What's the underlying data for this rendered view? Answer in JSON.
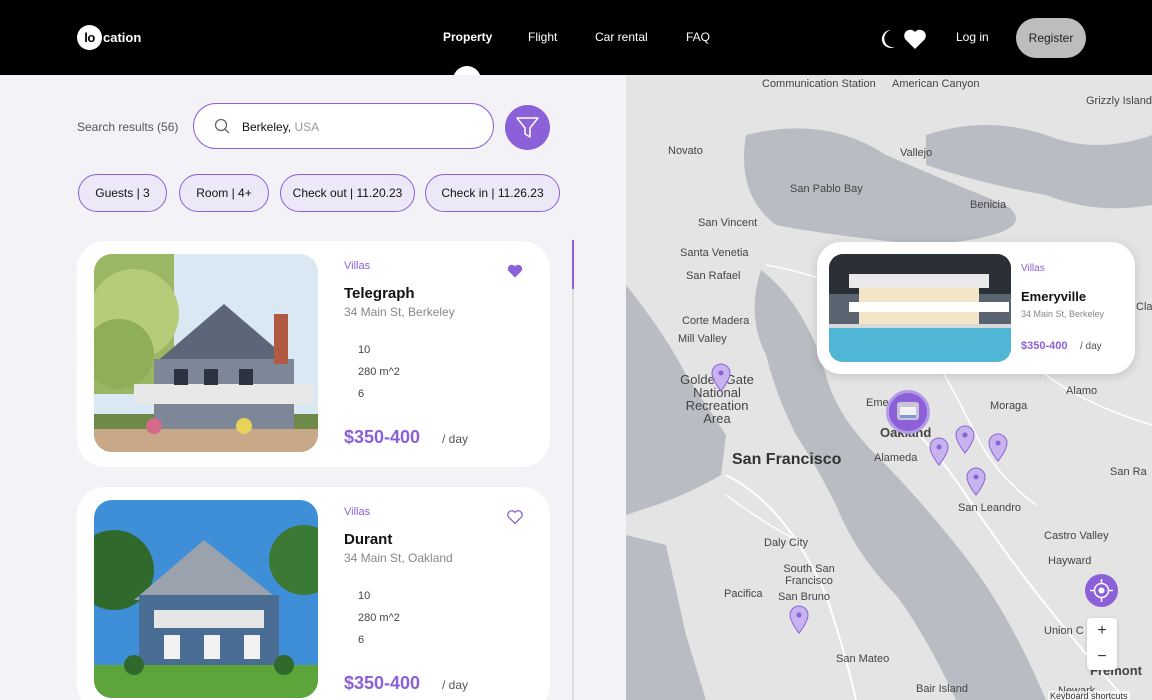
{
  "header": {
    "logo_mark": "lo",
    "logo_rest": "cation",
    "nav": [
      "Property",
      "Flight",
      "Car rental",
      "FAQ"
    ],
    "active_nav": "Property",
    "login": "Log in",
    "register": "Register"
  },
  "search": {
    "results_label": "Search results (56)",
    "city": "Berkeley,",
    "country": " USA"
  },
  "filters": [
    "Guests | 3",
    "Room | 4+",
    "Check out | 11.20.23",
    "Check in | 11.26.23"
  ],
  "listings": [
    {
      "category": "Villas",
      "name": "Telegraph",
      "address": "34 Main St, Berkeley",
      "specs": [
        "10",
        "280 m^2",
        "6"
      ],
      "price": "$350-400",
      "per": "/ day",
      "favorited": true
    },
    {
      "category": "Villas",
      "name": "Durant",
      "address": "34 Main St, Oakland",
      "specs": [
        "10",
        "280 m^2",
        "6"
      ],
      "price": "$350-400",
      "per": "/ day",
      "favorited": false
    }
  ],
  "map": {
    "popup": {
      "category": "Villas",
      "name": "Emeryville",
      "address": "34 Main St, Berkeley",
      "price": "$350-400",
      "per": "/ day"
    },
    "labels": {
      "communication": "Communication Station",
      "american": "American Canyon",
      "grizzly": "Grizzly Island Wildlife Are",
      "novato": "Novato",
      "vallejo": "Vallejo",
      "sanpablo": "San Pablo Bay",
      "benicia": "Benicia",
      "vincent": "San Vincent",
      "venetia": "Santa Venetia",
      "rafael": "San Rafael",
      "clay": "Clay",
      "corte": "Corte Madera",
      "mill": "Mill Valley",
      "golden": "Golden Gate National Recreation Area",
      "alamo": "Alamo",
      "moraga": "Moraga",
      "emery": "Eme",
      "oakland": "Oakland",
      "alameda": "Alameda",
      "sf": "San Francisco",
      "sanra": "San Ra",
      "leandro": "San Leandro",
      "daly": "Daly City",
      "ssf": "South San Francisco",
      "castro": "Castro Valley",
      "hayward": "Hayward",
      "pacifica": "Pacifica",
      "bruno": "San Bruno",
      "union": "Union C",
      "mateo": "San Mateo",
      "fremont": "Fremont",
      "bair": "Bair Island",
      "newark": "Newark"
    },
    "zoom_in": "+",
    "zoom_out": "−",
    "keyboard": "Keyboard shortcuts"
  },
  "colors": {
    "accent": "#8b60d8",
    "accent_light": "#ede8f8",
    "header_bg": "#000000"
  },
  "icons": [
    "moon-icon",
    "heart-icon",
    "search-icon",
    "filter-icon",
    "location-target-icon",
    "map-pin-icon"
  ]
}
